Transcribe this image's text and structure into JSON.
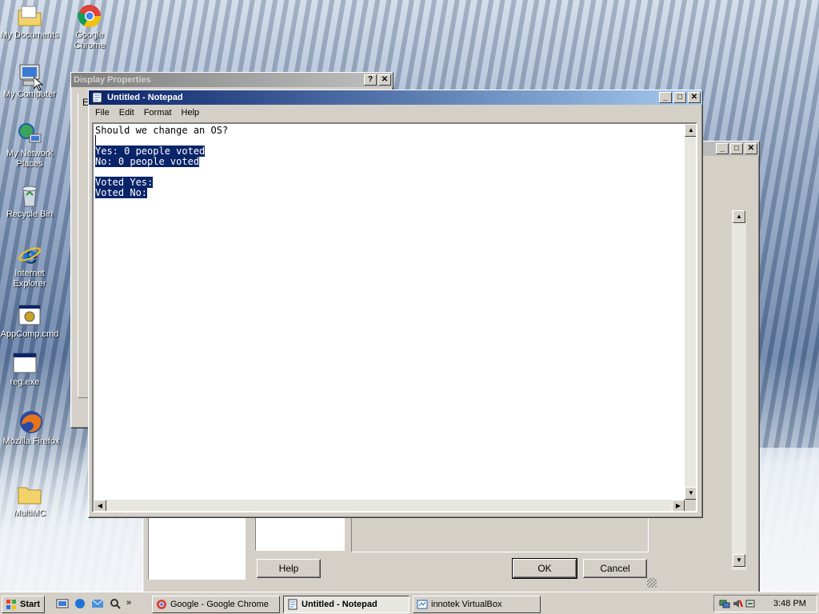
{
  "desktop": {
    "icons": [
      {
        "label": "My Documents"
      },
      {
        "label": "Google Chrome"
      },
      {
        "label": "My Computer"
      },
      {
        "label": "My Network Places"
      },
      {
        "label": "Recycle Bin"
      },
      {
        "label": "Internet Explorer"
      },
      {
        "label": "AppComp.cmd"
      },
      {
        "label": "reg.exe"
      },
      {
        "label": "Mozilla Firefox"
      },
      {
        "label": "MultiMC"
      }
    ]
  },
  "display_properties": {
    "title": "Display Properties",
    "help_button": "?",
    "close_button": "✕",
    "partial_text": "E"
  },
  "back_dialog": {
    "help_label": "Help",
    "ok_label": "OK",
    "cancel_label": "Cancel"
  },
  "notepad": {
    "title": "Untitled - Notepad",
    "menu": [
      "File",
      "Edit",
      "Format",
      "Help"
    ],
    "lines": {
      "l1": "Should we change an OS?",
      "l3": "Yes: 0 people voted",
      "l4": "No: 0 people voted",
      "l6": "Voted Yes:",
      "l7": "Voted No:"
    }
  },
  "taskbar": {
    "start_label": "Start",
    "tasks": [
      {
        "label": "Google - Google Chrome"
      },
      {
        "label": "Untitled - Notepad"
      },
      {
        "label": "innotek VirtualBox"
      }
    ],
    "clock": "3:48 PM"
  },
  "colors": {
    "title_active": "#0a246a",
    "selection": "#0a246a",
    "face": "#d4d0c8"
  }
}
